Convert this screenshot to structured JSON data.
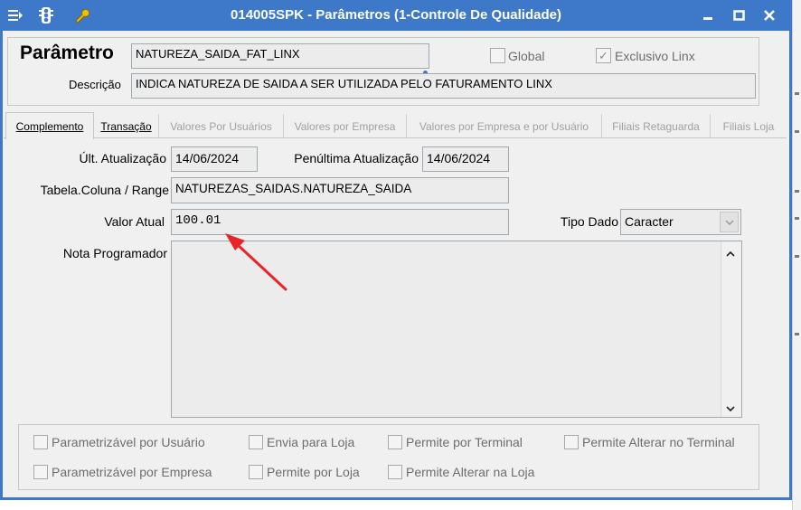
{
  "window": {
    "title": "014005SPK - Parâmetros (1-Controle De Qualidade)",
    "icons": [
      "menu-icon",
      "traffic-light-icon",
      "wrench-icon"
    ],
    "controls": {
      "minimize": "‒",
      "maximize": "☐",
      "close": "✕"
    }
  },
  "header": {
    "parametro_label": "Parâmetro",
    "parametro_value": "NATUREZA_SAIDA_FAT_LINX",
    "descricao_label": "Descrição",
    "descricao_value": "INDICA NATUREZA DE SAIDA A SER UTILIZADA PELO FATURAMENTO LINX",
    "global_label": "Global",
    "global_checked": false,
    "exclusivo_label": "Exclusivo Linx",
    "exclusivo_checked": true
  },
  "tabs": [
    {
      "label": "Complemento",
      "state": "active"
    },
    {
      "label": "Transação",
      "state": "enabled"
    },
    {
      "label": "Valores Por Usuários",
      "state": "disabled"
    },
    {
      "label": "Valores por Empresa",
      "state": "disabled"
    },
    {
      "label": "Valores por Empresa e por Usuário",
      "state": "disabled"
    },
    {
      "label": "Filiais Retaguarda",
      "state": "disabled"
    },
    {
      "label": "Filiais Loja",
      "state": "disabled"
    }
  ],
  "complemento": {
    "ult_atualizacao_label": "Últ. Atualização",
    "ult_atualizacao_value": "14/06/2024",
    "penultima_label": "Penúltima Atualização",
    "penultima_value": "14/06/2024",
    "tabela_label": "Tabela.Coluna / Range",
    "tabela_value": "NATUREZAS_SAIDAS.NATUREZA_SAIDA",
    "valor_label": "Valor Atual",
    "valor_value": "100.01",
    "tipo_label": "Tipo Dado",
    "tipo_value": "Caracter",
    "nota_label": "Nota Programador",
    "nota_value": ""
  },
  "options": [
    {
      "label": "Parametrizável por Usuário",
      "checked": false
    },
    {
      "label": "Envia para Loja",
      "checked": false
    },
    {
      "label": "Permite por Terminal",
      "checked": false
    },
    {
      "label": "Permite Alterar no Terminal",
      "checked": false
    },
    {
      "label": "Parametrizável por Empresa",
      "checked": false
    },
    {
      "label": "Permite por Loja",
      "checked": false
    },
    {
      "label": "Permite Alterar na Loja",
      "checked": false
    }
  ],
  "colors": {
    "titlebar": "#3e78c8",
    "annotation_arrow": "#e8262a"
  }
}
